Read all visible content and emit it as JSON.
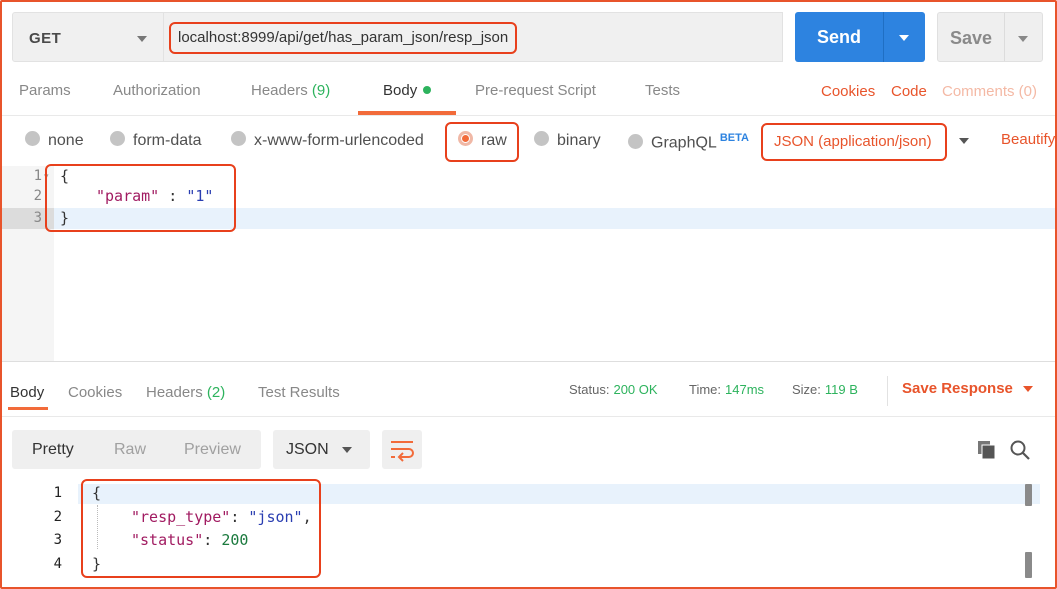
{
  "request": {
    "method": "GET",
    "url": "localhost:8999/api/get/has_param_json/resp_json",
    "send_label": "Send",
    "save_label": "Save"
  },
  "request_tabs": {
    "params": "Params",
    "authorization": "Authorization",
    "headers": "Headers",
    "headers_count": "(9)",
    "body": "Body",
    "prerequest": "Pre-request Script",
    "tests": "Tests",
    "cookies": "Cookies",
    "code": "Code",
    "comments": "Comments (0)"
  },
  "body_types": {
    "none": "none",
    "form_data": "form-data",
    "urlencoded": "x-www-form-urlencoded",
    "raw": "raw",
    "binary": "binary",
    "graphql": "GraphQL",
    "beta": "BETA",
    "content_type": "JSON (application/json)",
    "beautify": "Beautify"
  },
  "request_body": {
    "line_numbers": [
      "1",
      "2",
      "3"
    ],
    "open_brace": "{",
    "key": "\"param\"",
    "sep": " : ",
    "value": "\"1\"",
    "close_brace": "}"
  },
  "response_tabs": {
    "body": "Body",
    "cookies": "Cookies",
    "headers": "Headers",
    "headers_count": "(2)",
    "test_results": "Test Results"
  },
  "response_meta": {
    "status_label": "Status:",
    "status_value": "200 OK",
    "time_label": "Time:",
    "time_value": "147ms",
    "size_label": "Size:",
    "size_value": "119 B",
    "save_response": "Save Response"
  },
  "view": {
    "pretty": "Pretty",
    "raw": "Raw",
    "preview": "Preview",
    "format": "JSON"
  },
  "response_body": {
    "line_numbers": [
      "1",
      "2",
      "3",
      "4"
    ],
    "open_brace": "{",
    "key1": "\"resp_type\"",
    "val1": "\"json\"",
    "key2": "\"status\"",
    "val2": "200",
    "close_brace": "}"
  },
  "colors": {
    "accent": "#f26b3a",
    "highlight_box": "#e8401c",
    "send_blue": "#2d83e0",
    "success_green": "#2db35d"
  }
}
